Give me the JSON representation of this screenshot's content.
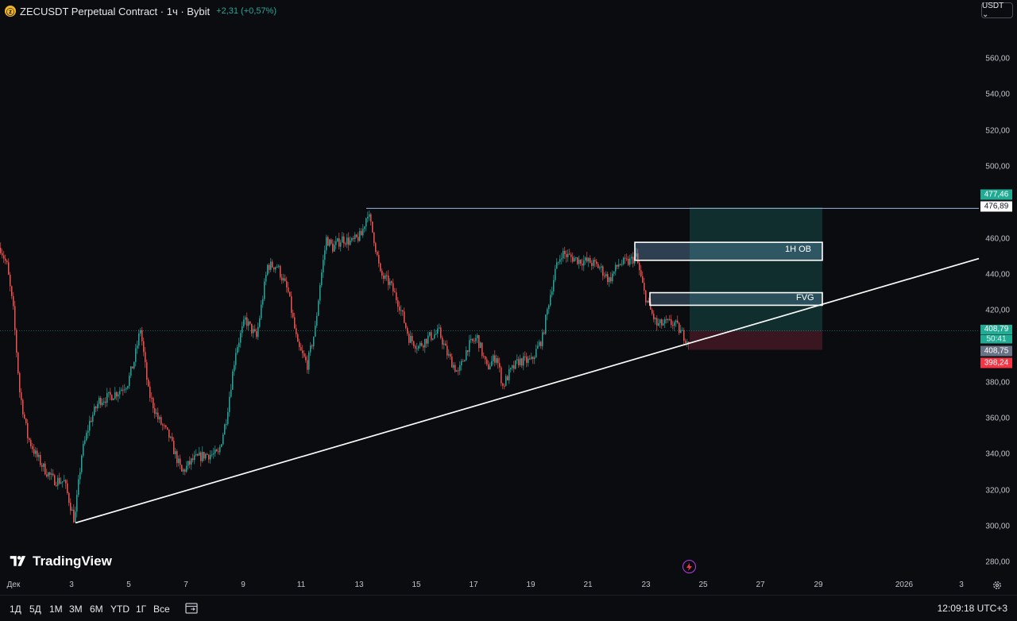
{
  "header": {
    "coin_icon": "zcash-coin-icon",
    "title": "ZECUSDT Perpetual Contract · 1ч · Bybit",
    "change": "+2,31 (+0,57%)",
    "currency_button": "USDT ⌄"
  },
  "price_axis": {
    "labels": [
      "560,00",
      "540,00",
      "520,00",
      "500,00",
      "460,00",
      "440,00",
      "420,00",
      "380,00",
      "360,00",
      "340,00",
      "320,00",
      "300,00",
      "280,00"
    ],
    "label_values": [
      560,
      540,
      520,
      500,
      460,
      440,
      420,
      380,
      360,
      340,
      320,
      300,
      280
    ],
    "badges": {
      "target": "477,46",
      "level": "476,89",
      "last_price": "408,79",
      "countdown": "50:41",
      "entry": "408,75",
      "stop": "398,24"
    }
  },
  "time_axis": {
    "labels": [
      "Дек",
      "3",
      "5",
      "7",
      "9",
      "11",
      "13",
      "15",
      "17",
      "19",
      "21",
      "23",
      "25",
      "27",
      "29",
      "2026",
      "3"
    ],
    "settings_icon": "gear-icon"
  },
  "drawings": {
    "order_block_label": "1H OB",
    "fvg_label": "FVG",
    "order_block_range": [
      448,
      458
    ],
    "fvg_range": [
      423,
      430
    ],
    "resistance_level": 476.89,
    "position": {
      "entry": 408.75,
      "target": 477.46,
      "stop": 398.24
    }
  },
  "chart_data": {
    "type": "candlestick",
    "symbol": "ZECUSDT",
    "interval": "1h",
    "ylim": [
      277,
      583
    ],
    "x": [
      "Дек 1",
      "3",
      "5",
      "7",
      "9",
      "11",
      "13",
      "15",
      "17",
      "19",
      "21",
      "23",
      "24"
    ],
    "close": [
      455,
      303,
      350,
      328,
      420,
      395,
      475,
      405,
      375,
      395,
      452,
      450,
      408.79
    ],
    "trendline": {
      "from": [
        "Dec 2",
        302
      ],
      "to": [
        "Dec 29",
        449
      ]
    },
    "colors": {
      "up": "#26a69a",
      "down": "#ef5350",
      "long_zone": "#0f2e2d",
      "short_zone": "#3a1620"
    }
  },
  "branding": {
    "logo_icon": "tradingview-logo-icon",
    "name": "TradingView",
    "flash_icon": "lightning-icon"
  },
  "bottom_bar": {
    "timeframes": [
      "1Д",
      "5Д",
      "1М",
      "3М",
      "6М",
      "YTD",
      "1Г",
      "Все"
    ],
    "calendar_icon": "calendar-range-icon",
    "clock": "12:09:18 UTC+3"
  }
}
